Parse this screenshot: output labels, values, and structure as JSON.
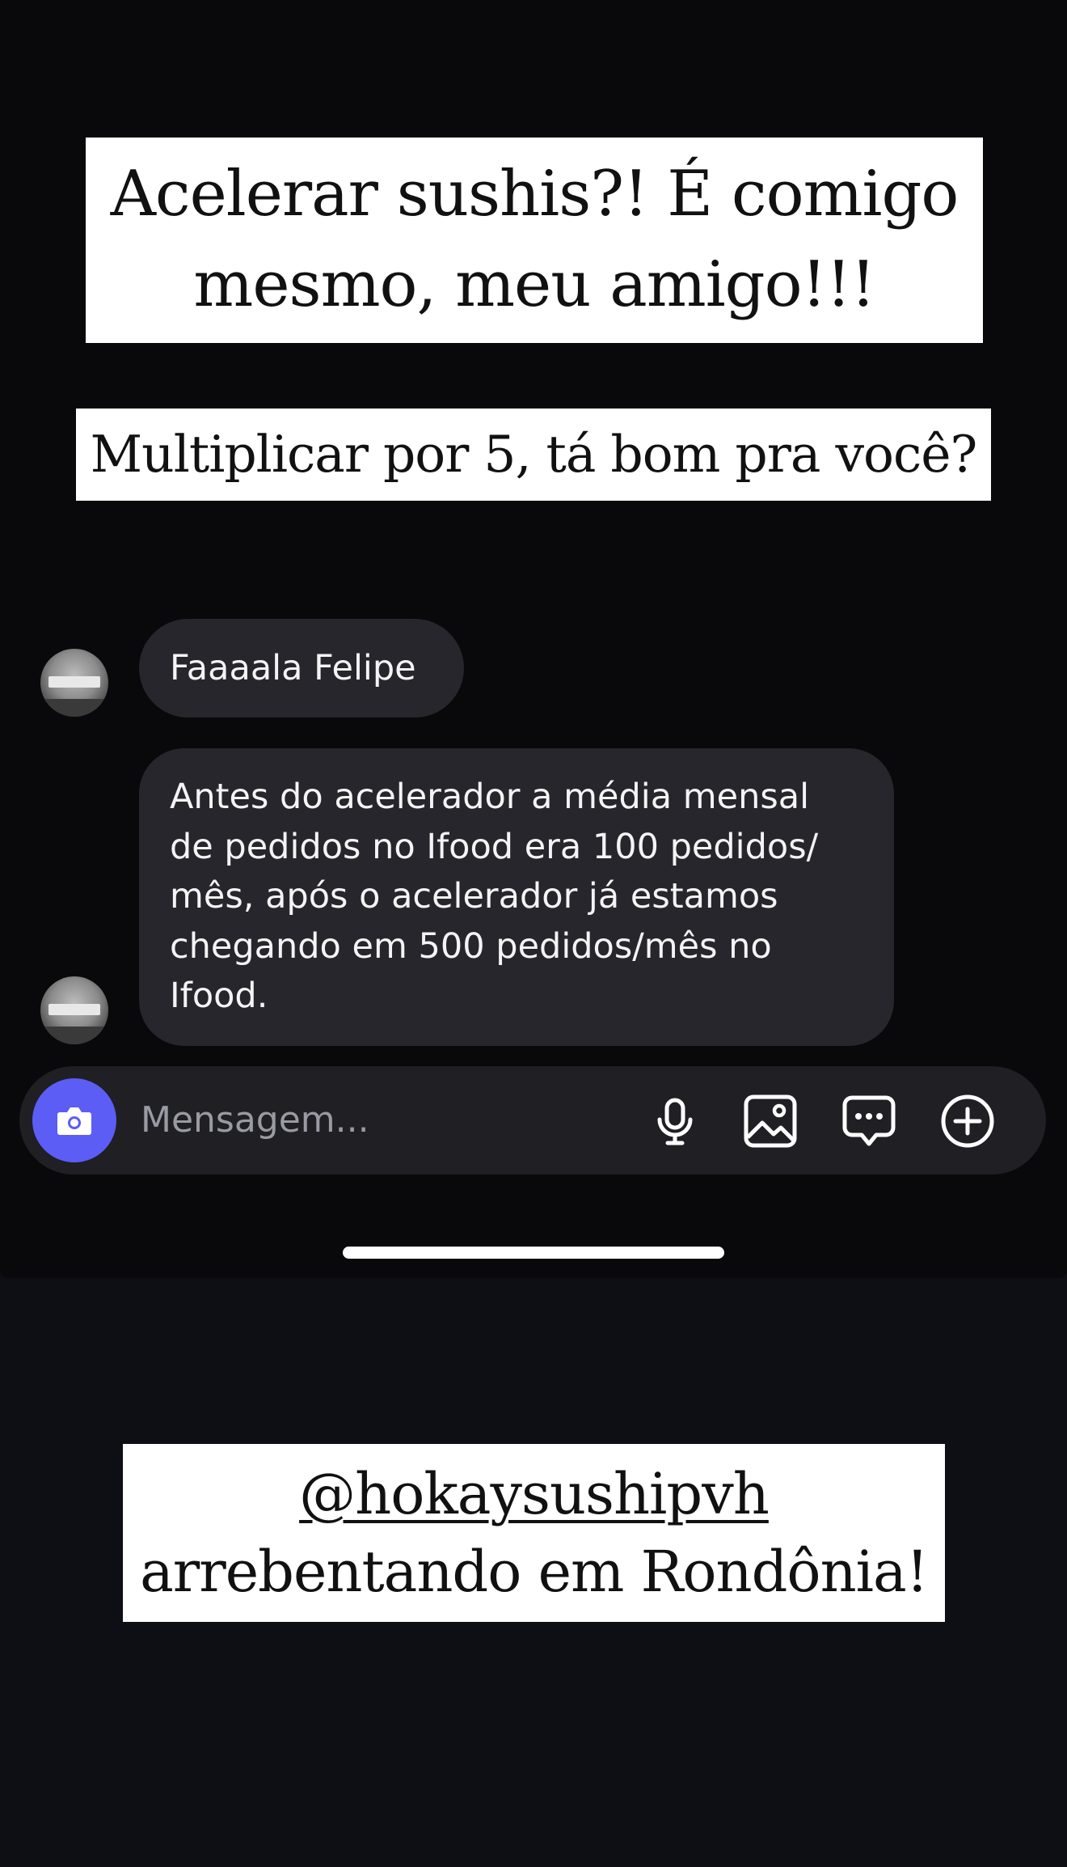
{
  "story": {
    "caption_top_line1": "Acelerar sushis?! É comigo",
    "caption_top_line2": "mesmo, meu amigo!!!",
    "caption_middle": "Multiplicar por 5, tá bom pra você?",
    "caption_bottom_handle": "@hokaysushipvh",
    "caption_bottom_line2": "arrebentando em Rondônia!"
  },
  "chat": {
    "messages": [
      {
        "text": "Faaaala Felipe"
      },
      {
        "lines": [
          "Antes do acelerador a média mensal",
          "de pedidos no Ifood era 100 pedidos/",
          "mês, após o acelerador já estamos",
          "chegando em 500 pedidos/mês no",
          "Ifood."
        ]
      }
    ]
  },
  "composer": {
    "placeholder": "Mensagem...",
    "icons": [
      "camera-icon",
      "microphone-icon",
      "image-icon",
      "sticker-chat-icon",
      "plus-circle-icon"
    ],
    "camera_color": "#5b5df5"
  },
  "colors": {
    "background": "#09090b",
    "bubble": "#26262c",
    "caption_bg": "#ffffff"
  }
}
